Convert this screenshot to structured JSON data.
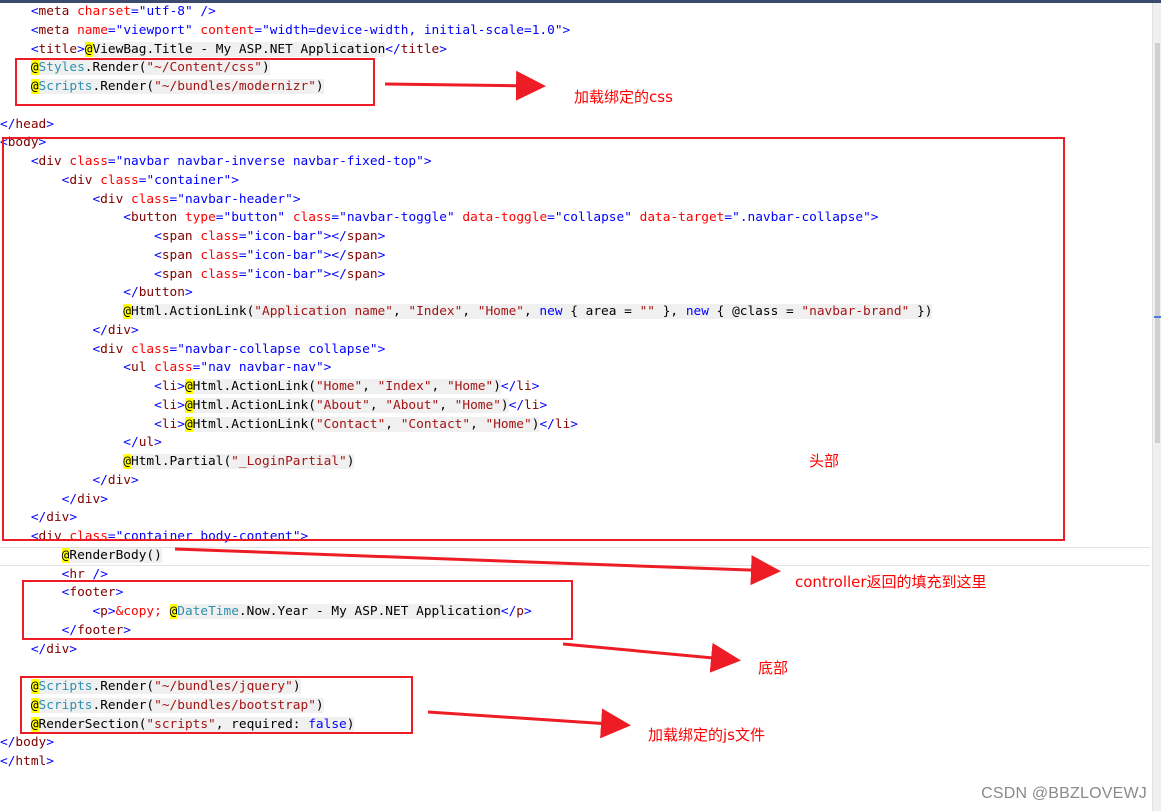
{
  "code_lines": [
    "    <meta charset=\"utf-8\" />",
    "    <meta name=\"viewport\" content=\"width=device-width, initial-scale=1.0\">",
    "    <title>@ViewBag.Title - My ASP.NET Application</title>",
    "    @Styles.Render(\"~/Content/css\")",
    "    @Scripts.Render(\"~/bundles/modernizr\")",
    "",
    "</head>",
    "<body>",
    "    <div class=\"navbar navbar-inverse navbar-fixed-top\">",
    "        <div class=\"container\">",
    "            <div class=\"navbar-header\">",
    "                <button type=\"button\" class=\"navbar-toggle\" data-toggle=\"collapse\" data-target=\".navbar-collapse\">",
    "                    <span class=\"icon-bar\"></span>",
    "                    <span class=\"icon-bar\"></span>",
    "                    <span class=\"icon-bar\"></span>",
    "                </button>",
    "                @Html.ActionLink(\"Application name\", \"Index\", \"Home\", new { area = \"\" }, new { @class = \"navbar-brand\" })",
    "            </div>",
    "            <div class=\"navbar-collapse collapse\">",
    "                <ul class=\"nav navbar-nav\">",
    "                    <li>@Html.ActionLink(\"Home\", \"Index\", \"Home\")</li>",
    "                    <li>@Html.ActionLink(\"About\", \"About\", \"Home\")</li>",
    "                    <li>@Html.ActionLink(\"Contact\", \"Contact\", \"Home\")</li>",
    "                </ul>",
    "                @Html.Partial(\"_LoginPartial\")",
    "            </div>",
    "        </div>",
    "    </div>",
    "    <div class=\"container body-content\">",
    "        @RenderBody()",
    "        <hr />",
    "        <footer>",
    "            <p>&copy; @DateTime.Now.Year - My ASP.NET Application</p>",
    "        </footer>",
    "    </div>",
    "",
    "    @Scripts.Render(\"~/bundles/jquery\")",
    "    @Scripts.Render(\"~/bundles/bootstrap\")",
    "    @RenderSection(\"scripts\", required: false)",
    "</body>",
    "</html>"
  ],
  "annotations": {
    "css": "加载绑定的css",
    "header": "头部",
    "controller": "controller返回的填充到这里",
    "footer": "底部",
    "js": "加载绑定的js文件"
  },
  "watermark": "CSDN @BBZLOVEWJ",
  "colors": {
    "annotation_red": "#ee1c24",
    "razor_highlight": "#ffff00",
    "html_tag": "#800000",
    "html_attribute": "#ff0000",
    "string": "#0000ff",
    "razor_string": "#a31515",
    "type_name": "#2b91af"
  }
}
